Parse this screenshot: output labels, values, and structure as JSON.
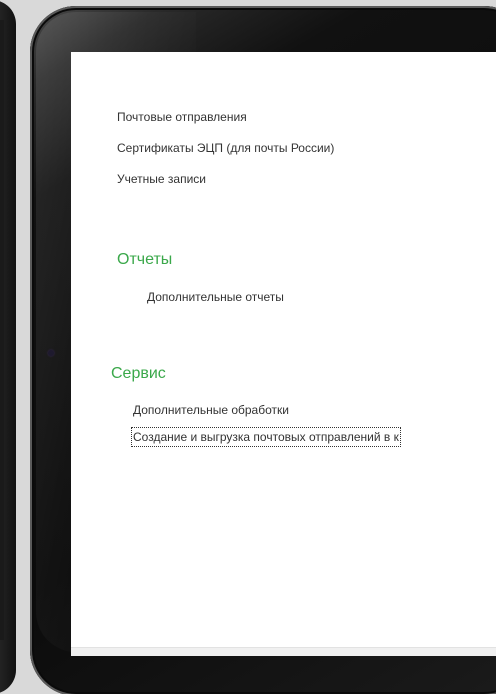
{
  "screen": {
    "links": [
      "Почтовые отправления",
      "Сертификаты ЭЦП (для почты России)",
      "Учетные записи"
    ],
    "reports_section": {
      "title": "Отчеты",
      "items": [
        "Дополнительные отчеты"
      ]
    },
    "service_section": {
      "title": "Сервис",
      "items": [
        "Дополнительные обработки",
        "Создание и выгрузка почтовых отправлений в к"
      ]
    }
  },
  "colors": {
    "section_title": "#3aa84a",
    "link_text": "#333333",
    "bezel": "#111111",
    "background": "#d9d9d9"
  }
}
